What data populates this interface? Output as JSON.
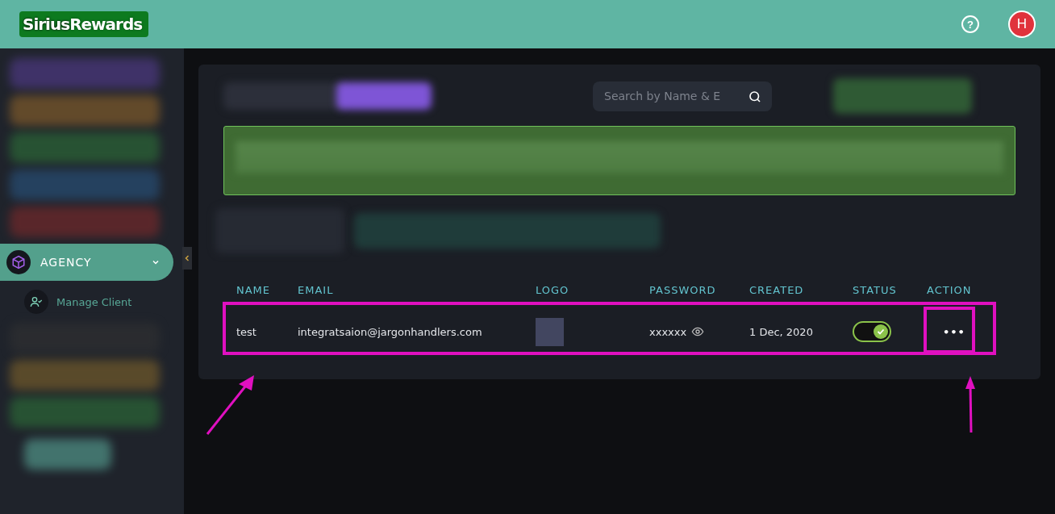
{
  "header": {
    "brand_first": "Sirius",
    "brand_second": "Rewards",
    "help_icon": "?",
    "avatar": "H"
  },
  "sidebar": {
    "group": {
      "label": "AGENCY",
      "expanded": true,
      "children": [
        {
          "label": "Manage Client",
          "selected": true
        }
      ]
    }
  },
  "search": {
    "placeholder": "Search by Name & E"
  },
  "table": {
    "columns": [
      "NAME",
      "EMAIL",
      "LOGO",
      "PASSWORD",
      "CREATED",
      "STATUS",
      "ACTION"
    ],
    "rows": [
      {
        "name": "test",
        "email": "integratsaion@jargonhandlers.com",
        "password": "xxxxxx",
        "created": "1 Dec, 2020",
        "status_on": true,
        "action": "•••",
        "highlighted": true
      }
    ]
  }
}
